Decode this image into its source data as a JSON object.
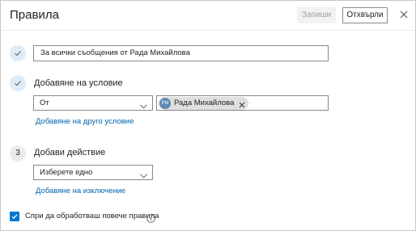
{
  "dialog": {
    "title": "Правила",
    "save_label": "Запиши",
    "discard_label": "Отхвърли"
  },
  "rule_name": {
    "value": "За всички съобщения от Рада Михайлова"
  },
  "condition": {
    "heading": "Добавяне на условие",
    "dropdown_value": "От",
    "chip_name": "Рада Михайлова",
    "chip_initials": "РМ",
    "add_condition_link": "Добавяне на друго условие"
  },
  "action": {
    "step_number": "3",
    "heading": "Добави действие",
    "dropdown_value": "Изберете едно",
    "add_exception_link": "Добавяне на изключение"
  },
  "stop_processing": {
    "label": "Спри да обработваш повече правила",
    "checked": true
  },
  "colors": {
    "accent": "#0078d4",
    "link": "#0062ad",
    "step_bg": "#deecf9",
    "avatar": "#5d89b3"
  },
  "icons": [
    "close-icon",
    "check-icon",
    "chevron-down-icon",
    "info-icon"
  ]
}
